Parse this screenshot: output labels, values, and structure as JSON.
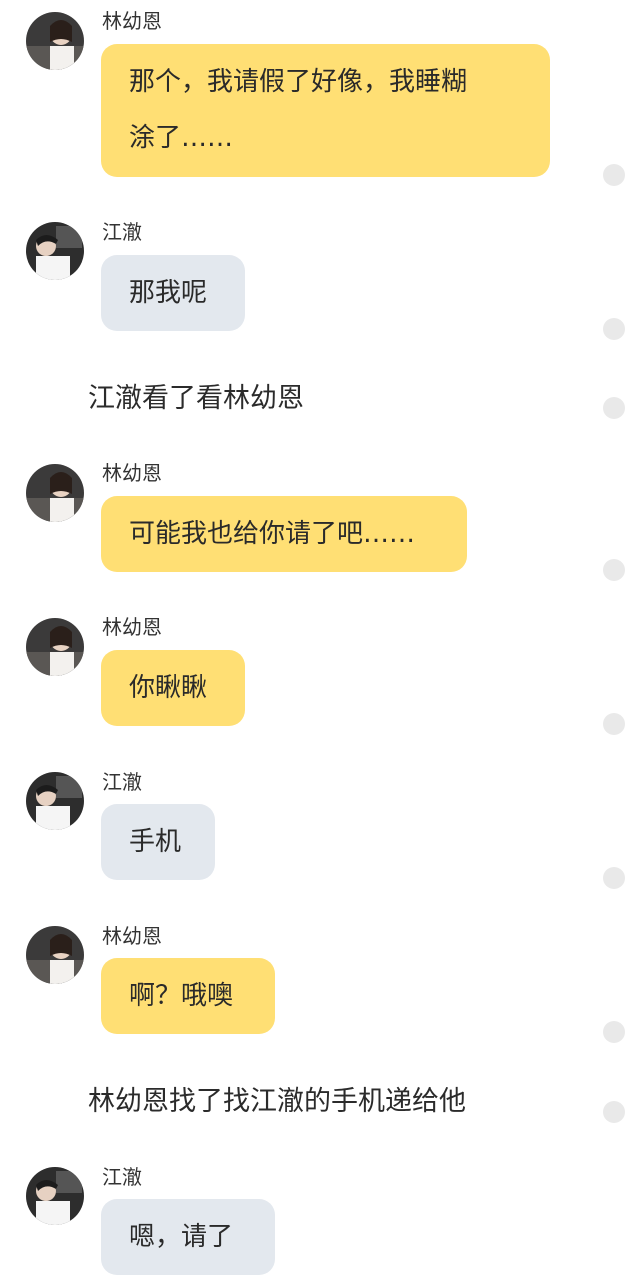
{
  "colors": {
    "lin_bubble": "#ffdf74",
    "jiang_bubble": "#e3e8ee",
    "background": "#ffffff",
    "comment_dot": "#e9e9e9"
  },
  "messages": [
    {
      "sender": "林幼恩",
      "text": "那个，我请假了好像，我睡糊\n涂了……"
    },
    {
      "sender": "江澈",
      "text": "那我呢"
    },
    {
      "narration": "江澈看了看林幼恩"
    },
    {
      "sender": "林幼恩",
      "text": "可能我也给你请了吧……"
    },
    {
      "sender": "林幼恩",
      "text": "你瞅瞅"
    },
    {
      "sender": "江澈",
      "text": "手机"
    },
    {
      "sender": "林幼恩",
      "text": "啊？哦噢"
    },
    {
      "narration": "林幼恩找了找江澈的手机递给他"
    },
    {
      "sender": "江澈",
      "text": "嗯，请了"
    }
  ]
}
